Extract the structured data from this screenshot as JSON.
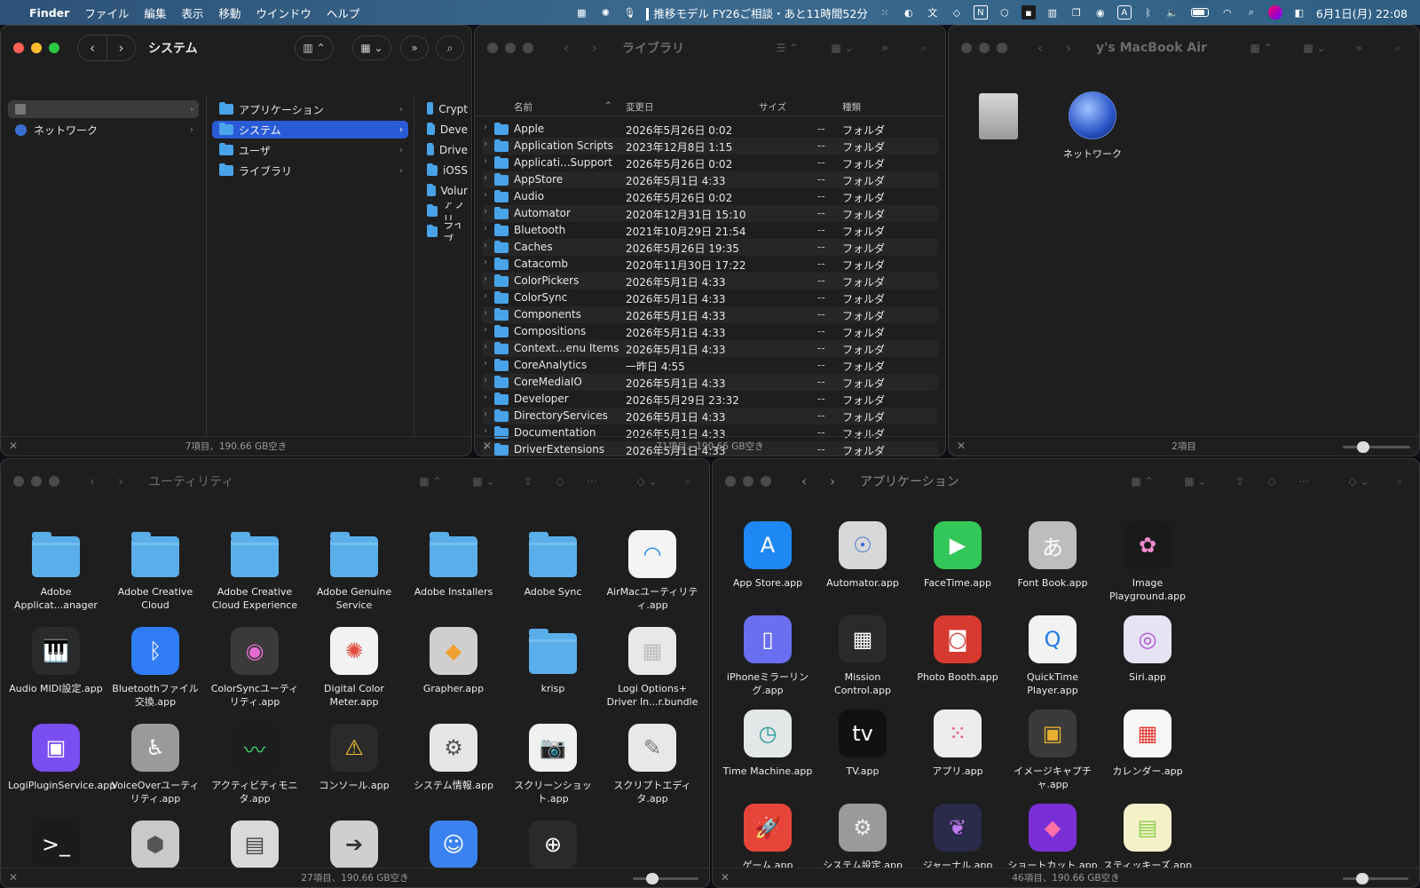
{
  "menubar": {
    "app": "Finder",
    "items": [
      "ファイル",
      "編集",
      "表示",
      "移動",
      "ウインドウ",
      "ヘルプ"
    ],
    "status_text": "推移モデル FY26ご相談・あと11時間52分",
    "input_mode": "A",
    "clock": "6月1日(月) 22:08"
  },
  "win1": {
    "title": "システム",
    "footer": "7項目、190.66 GB空き",
    "sidebar": [
      {
        "label": ""
      },
      {
        "label": "ネットワーク"
      }
    ],
    "col2": [
      "アプリケーション",
      "システム",
      "ユーザ",
      "ライブラリ"
    ],
    "col3": [
      "Crypt",
      "Deve",
      "Drive",
      "iOSS",
      "Volur",
      "アプリ",
      "ライブ"
    ]
  },
  "win2": {
    "title": "ライブラリ",
    "footer": "71項目、190.66 GB空き",
    "headers": {
      "name": "名前",
      "modified": "変更日",
      "size": "サイズ",
      "kind": "種類"
    },
    "rows": [
      {
        "name": "Apple",
        "date": "2026年5月26日 0:02",
        "size": "--",
        "kind": "フォルダ"
      },
      {
        "name": "Application Scripts",
        "date": "2023年12月8日 1:15",
        "size": "--",
        "kind": "フォルダ"
      },
      {
        "name": "Applicati...Support",
        "date": "2026年5月26日 0:02",
        "size": "--",
        "kind": "フォルダ"
      },
      {
        "name": "AppStore",
        "date": "2026年5月1日 4:33",
        "size": "--",
        "kind": "フォルダ"
      },
      {
        "name": "Audio",
        "date": "2026年5月26日 0:02",
        "size": "--",
        "kind": "フォルダ"
      },
      {
        "name": "Automator",
        "date": "2020年12月31日 15:10",
        "size": "--",
        "kind": "フォルダ"
      },
      {
        "name": "Bluetooth",
        "date": "2021年10月29日 21:54",
        "size": "--",
        "kind": "フォルダ"
      },
      {
        "name": "Caches",
        "date": "2026年5月26日 19:35",
        "size": "--",
        "kind": "フォルダ"
      },
      {
        "name": "Catacomb",
        "date": "2020年11月30日 17:22",
        "size": "--",
        "kind": "フォルダ"
      },
      {
        "name": "ColorPickers",
        "date": "2026年5月1日 4:33",
        "size": "--",
        "kind": "フォルダ"
      },
      {
        "name": "ColorSync",
        "date": "2026年5月1日 4:33",
        "size": "--",
        "kind": "フォルダ"
      },
      {
        "name": "Components",
        "date": "2026年5月1日 4:33",
        "size": "--",
        "kind": "フォルダ"
      },
      {
        "name": "Compositions",
        "date": "2026年5月1日 4:33",
        "size": "--",
        "kind": "フォルダ"
      },
      {
        "name": "Context...enu Items",
        "date": "2026年5月1日 4:33",
        "size": "--",
        "kind": "フォルダ"
      },
      {
        "name": "CoreAnalytics",
        "date": "一昨日 4:55",
        "size": "--",
        "kind": "フォルダ"
      },
      {
        "name": "CoreMediaIO",
        "date": "2026年5月1日 4:33",
        "size": "--",
        "kind": "フォルダ"
      },
      {
        "name": "Developer",
        "date": "2026年5月29日 23:32",
        "size": "--",
        "kind": "フォルダ"
      },
      {
        "name": "DirectoryServices",
        "date": "2026年5月1日 4:33",
        "size": "--",
        "kind": "フォルダ"
      },
      {
        "name": "Documentation",
        "date": "2026年5月1日 4:33",
        "size": "--",
        "kind": "フォルダ"
      },
      {
        "name": "DriverExtensions",
        "date": "2026年5月1日 4:33",
        "size": "--",
        "kind": "フォルダ"
      }
    ]
  },
  "win3": {
    "title": "y's MacBook Air",
    "footer": "2項目",
    "network_label": "ネットワーク",
    "icon_size": 0.3
  },
  "win4": {
    "title": "ユーティリティ",
    "footer": "27項目、190.66 GB空き",
    "icon_size": 0.3,
    "items": [
      {
        "label": "Adobe Applicat...anager",
        "icon": "folder-icon"
      },
      {
        "label": "Adobe Creative Cloud",
        "icon": "folder-icon"
      },
      {
        "label": "Adobe Creative Cloud Experience",
        "icon": "folder-icon"
      },
      {
        "label": "Adobe Genuine Service",
        "icon": "folder-icon"
      },
      {
        "label": "Adobe Installers",
        "icon": "folder-icon"
      },
      {
        "label": "Adobe Sync",
        "icon": "folder-icon"
      },
      {
        "label": "AirMacユーティリティ.app",
        "icon": "wifi-icon",
        "bg": "#f4f4f4",
        "glyph": "◠",
        "color": "#1a7cf5"
      },
      {
        "label": "Audio MIDI設定.app",
        "icon": "piano-icon",
        "bg": "#2a2a2a",
        "glyph": "🎹",
        "color": "#fff"
      },
      {
        "label": "Bluetoothファイル交換.app",
        "icon": "bluetooth-icon",
        "bg": "#2f7cf6",
        "glyph": "ᛒ",
        "color": "#fff"
      },
      {
        "label": "ColorSyncユーティリティ.app",
        "icon": "colorsync-icon",
        "bg": "#3a3a3a",
        "glyph": "◉",
        "color": "#e86bd3"
      },
      {
        "label": "Digital Color Meter.app",
        "icon": "color-meter-icon",
        "bg": "#f2f2f2",
        "glyph": "✺",
        "color": "#e24a3b"
      },
      {
        "label": "Grapher.app",
        "icon": "grapher-icon",
        "bg": "#cfcfcf",
        "glyph": "◆",
        "color": "#f0a030"
      },
      {
        "label": "krisp",
        "icon": "folder-icon"
      },
      {
        "label": "Logi Options+ Driver In...r.bundle",
        "icon": "lego-icon",
        "bg": "#e8e8e8",
        "glyph": "▦",
        "color": "#bdbdbd"
      },
      {
        "label": "LogiPluginService.app",
        "icon": "logi-plugin-icon",
        "bg": "#7a4ef0",
        "glyph": "▣",
        "color": "#fff"
      },
      {
        "label": "VoiceOverユーティリティ.app",
        "icon": "accessibility-icon",
        "bg": "#9a9a9a",
        "glyph": "♿",
        "color": "#fff"
      },
      {
        "label": "アクティビティモニタ.app",
        "icon": "activity-monitor-icon",
        "bg": "#1d1d1d",
        "glyph": "〰",
        "color": "#3ed36b"
      },
      {
        "label": "コンソール.app",
        "icon": "console-icon",
        "bg": "#2a2a2a",
        "glyph": "⚠",
        "color": "#f2c230"
      },
      {
        "label": "システム情報.app",
        "icon": "system-info-icon",
        "bg": "#e6e6e6",
        "glyph": "⚙",
        "color": "#555"
      },
      {
        "label": "スクリーンショット.app",
        "icon": "screenshot-icon",
        "bg": "#f0f0f0",
        "glyph": "📷",
        "color": "#333"
      },
      {
        "label": "スクリプトエディタ.app",
        "icon": "script-editor-icon",
        "bg": "#e8e8e8",
        "glyph": "✎",
        "color": "#777"
      },
      {
        "label": "",
        "icon": "terminal-icon",
        "bg": "#1b1b1b",
        "glyph": ">_",
        "color": "#fff"
      },
      {
        "label": "",
        "icon": "boot-camp-icon",
        "bg": "#c9c9c9",
        "glyph": "⬢",
        "color": "#555"
      },
      {
        "label": "",
        "icon": "printer-icon",
        "bg": "#d9d9d9",
        "glyph": "▤",
        "color": "#444"
      },
      {
        "label": "",
        "icon": "migration-icon",
        "bg": "#cfcfcf",
        "glyph": "➔",
        "color": "#333"
      },
      {
        "label": "",
        "icon": "directory-utility-icon",
        "bg": "#3a82f0",
        "glyph": "☺",
        "color": "#fff"
      },
      {
        "label": "",
        "icon": "magnifier-icon",
        "bg": "#2a2a2a",
        "glyph": "⊕",
        "color": "#fff"
      }
    ]
  },
  "win5": {
    "title": "アプリケーション",
    "footer": "46項目、190.66 GB空き",
    "icon_size": 0.3,
    "items": [
      {
        "label": "App Store.app",
        "icon": "app-store-icon",
        "bg": "#1e88f5",
        "glyph": "A",
        "color": "#fff"
      },
      {
        "label": "Automator.app",
        "icon": "automator-icon",
        "bg": "#d8d8d8",
        "glyph": "☉",
        "color": "#3a6fd0"
      },
      {
        "label": "FaceTime.app",
        "icon": "facetime-icon",
        "bg": "#33c759",
        "glyph": "▶",
        "color": "#fff"
      },
      {
        "label": "Font Book.app",
        "icon": "font-book-icon",
        "bg": "#bdbdbd",
        "glyph": "あ",
        "color": "#fff"
      },
      {
        "label": "Image Playground.app",
        "icon": "image-playground-icon",
        "bg": "#1a1a1a",
        "glyph": "✿",
        "color": "#f08ad0"
      },
      {
        "label": "iPhoneミラーリング.app",
        "icon": "iphone-mirroring-icon",
        "bg": "#6a6ef0",
        "glyph": "▯",
        "color": "#fff"
      },
      {
        "label": "Mission Control.app",
        "icon": "mission-control-icon",
        "bg": "#2a2a2a",
        "glyph": "▦",
        "color": "#fff"
      },
      {
        "label": "Photo Booth.app",
        "icon": "photo-booth-icon",
        "bg": "#d73a30",
        "glyph": "◙",
        "color": "#fff"
      },
      {
        "label": "QuickTime Player.app",
        "icon": "quicktime-icon",
        "bg": "#f2f2f2",
        "glyph": "Q",
        "color": "#1f7ae8"
      },
      {
        "label": "Siri.app",
        "icon": "siri-icon",
        "bg": "#e4e4f4",
        "glyph": "◎",
        "color": "#b34fd6"
      },
      {
        "label": "Time Machine.app",
        "icon": "time-machine-icon",
        "bg": "#e2e8e8",
        "glyph": "◷",
        "color": "#2a9a9a"
      },
      {
        "label": "TV.app",
        "icon": "tv-icon",
        "bg": "#111",
        "glyph": "tv",
        "color": "#fff"
      },
      {
        "label": "アプリ.app",
        "icon": "apps-icon",
        "bg": "#ececec",
        "glyph": "⁙",
        "color": "#e2497a"
      },
      {
        "label": "イメージキャプチャ.app",
        "icon": "image-capture-icon",
        "bg": "#3a3a3a",
        "glyph": "▣",
        "color": "#e8b030"
      },
      {
        "label": "カレンダー.app",
        "icon": "calendar-icon",
        "bg": "#f7f7f7",
        "glyph": "▦",
        "color": "#e23a30"
      },
      {
        "label": "ゲーム.app",
        "icon": "games-icon",
        "bg": "#e8453a",
        "glyph": "🚀",
        "color": "#fff"
      },
      {
        "label": "システム設定.app",
        "icon": "system-settings-icon",
        "bg": "#9a9a9a",
        "glyph": "⚙",
        "color": "#eee"
      },
      {
        "label": "ジャーナル.app",
        "icon": "journal-icon",
        "bg": "#2a2a4a",
        "glyph": "❦",
        "color": "#c07af0"
      },
      {
        "label": "ショートカット.app",
        "icon": "shortcuts-icon",
        "bg": "#7a2fd6",
        "glyph": "◆",
        "color": "#ff6fa8"
      },
      {
        "label": "スティッキーズ.app",
        "icon": "stickies-icon",
        "bg": "#f4f0c8",
        "glyph": "▤",
        "color": "#8bcf4a"
      }
    ]
  }
}
